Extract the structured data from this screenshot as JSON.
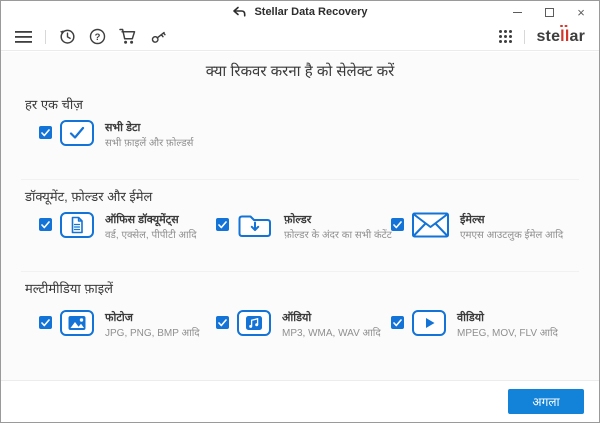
{
  "window": {
    "title": "Stellar Data Recovery",
    "controls": [
      "minimize",
      "maximize",
      "close"
    ]
  },
  "toolbar": {
    "left_icons": [
      "menu-icon",
      "history-icon",
      "help-icon",
      "cart-icon",
      "key-icon"
    ],
    "right_icons": [
      "apps-grid-icon"
    ],
    "brand": {
      "pre": "ste",
      "highlight": "ll",
      "post": "ar"
    }
  },
  "main": {
    "heading": "क्या रिकवर करना है को सेलेक्ट करें",
    "sections": [
      {
        "title": "हर एक चीज़",
        "items": [
          {
            "icon": "all-data-check-icon",
            "label": "सभी डेटा",
            "sublabel": "सभी फ़ाइलें और फ़ोल्डर्स",
            "checked": true
          }
        ]
      },
      {
        "title": "डॉक्यूमेंट, फ़ोल्डर और ईमेल",
        "items": [
          {
            "icon": "document-icon",
            "label": "ऑफिस डॉक्यूमेंट्स",
            "sublabel": "वर्ड, एक्सेल, पीपीटी आदि",
            "checked": true
          },
          {
            "icon": "folder-download-icon",
            "label": "फ़ोल्डर",
            "sublabel": "फ़ोल्डर के अंदर का सभी कंटेंट",
            "checked": true
          },
          {
            "icon": "envelope-icon",
            "label": "ईमेल्स",
            "sublabel": "एमएस आउटलुक ईमेल आदि",
            "checked": true
          }
        ]
      },
      {
        "title": "मल्टीमीडिया फ़ाइलें",
        "items": [
          {
            "icon": "photo-icon",
            "label": "फोटोज",
            "sublabel": "JPG, PNG, BMP आदि",
            "checked": true
          },
          {
            "icon": "audio-note-icon",
            "label": "ऑडियो",
            "sublabel": "MP3, WMA, WAV आदि",
            "checked": true
          },
          {
            "icon": "video-play-icon",
            "label": "वीडियो",
            "sublabel": "MPEG, MOV, FLV आदि",
            "checked": true
          }
        ]
      }
    ]
  },
  "footer": {
    "next_label": "अगला"
  },
  "colors": {
    "accent_blue": "#1373d6",
    "button_blue": "#1283d8",
    "logo_red": "#d63429",
    "content_bg": "#fbfbfb"
  }
}
